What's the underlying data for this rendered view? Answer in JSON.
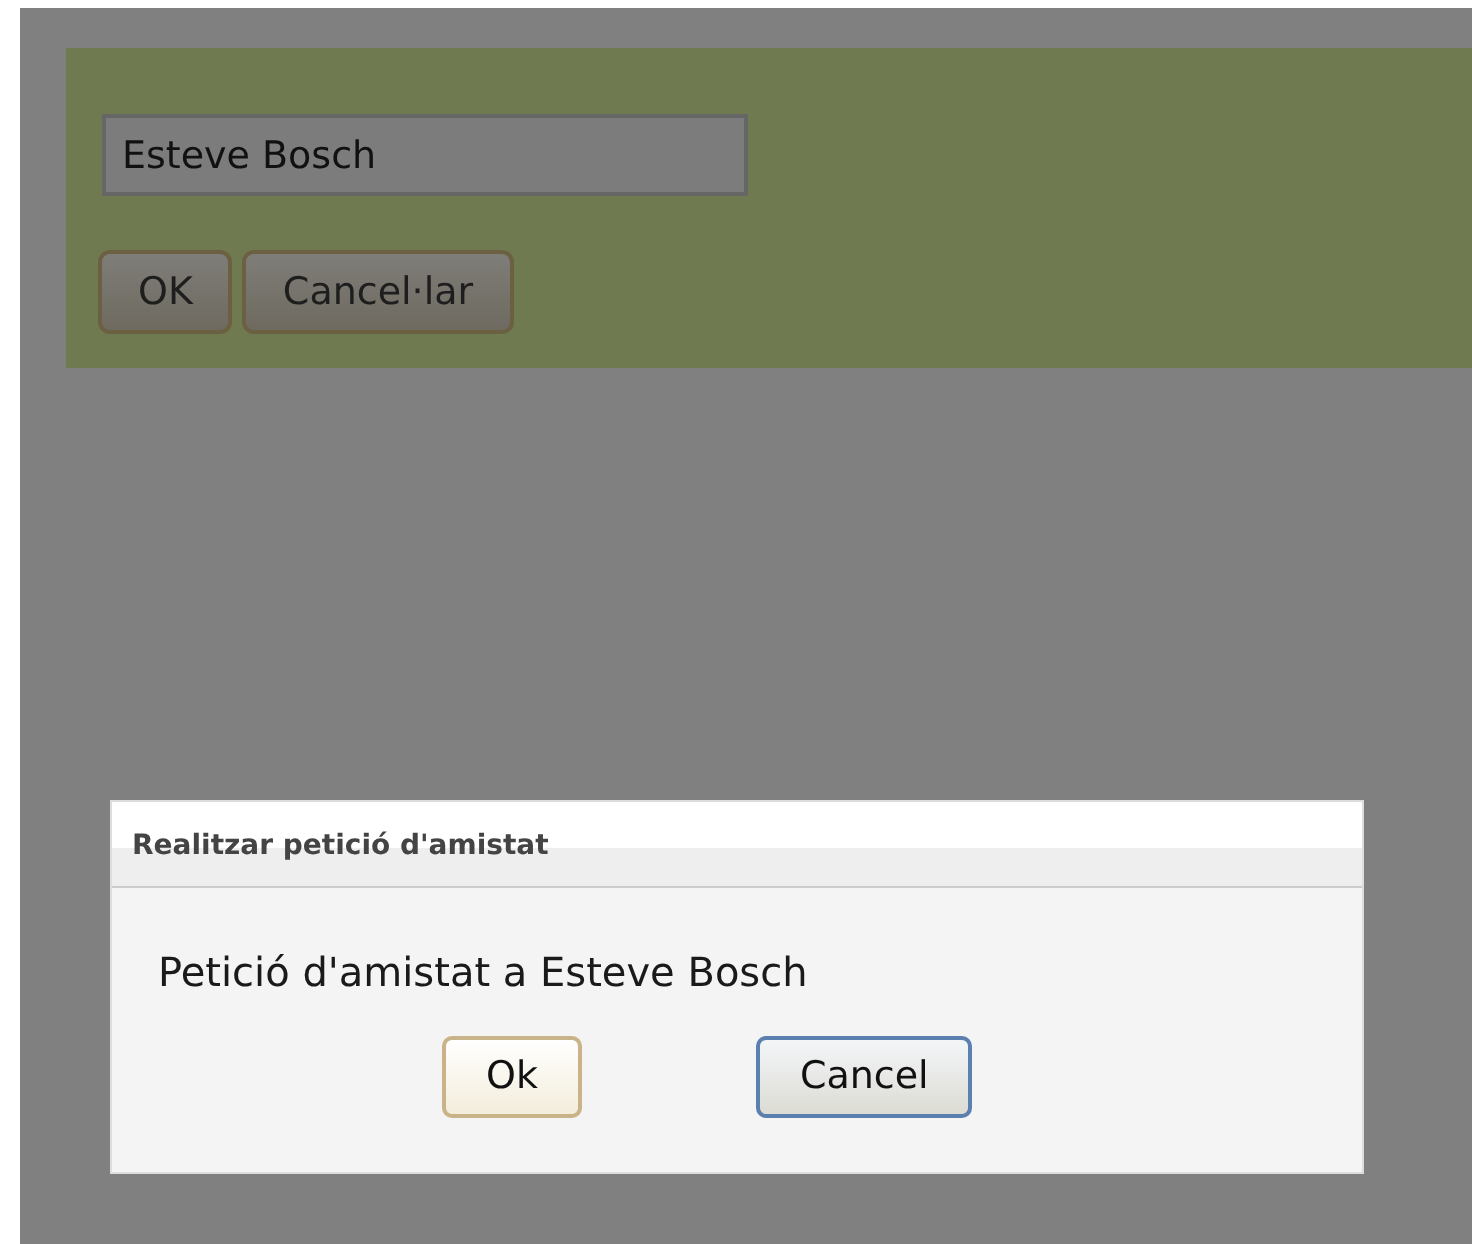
{
  "form": {
    "name_field": {
      "value": "Esteve Bosch"
    },
    "buttons": [
      {
        "label": "OK"
      },
      {
        "label": "Cancel·lar"
      }
    ]
  },
  "dialog": {
    "title": "Realitzar petició d'amistat",
    "message": "Petició d'amistat a Esteve Bosch",
    "buttons": [
      {
        "label": "Ok",
        "focused": false
      },
      {
        "label": "Cancel",
        "focused": true
      }
    ]
  }
}
